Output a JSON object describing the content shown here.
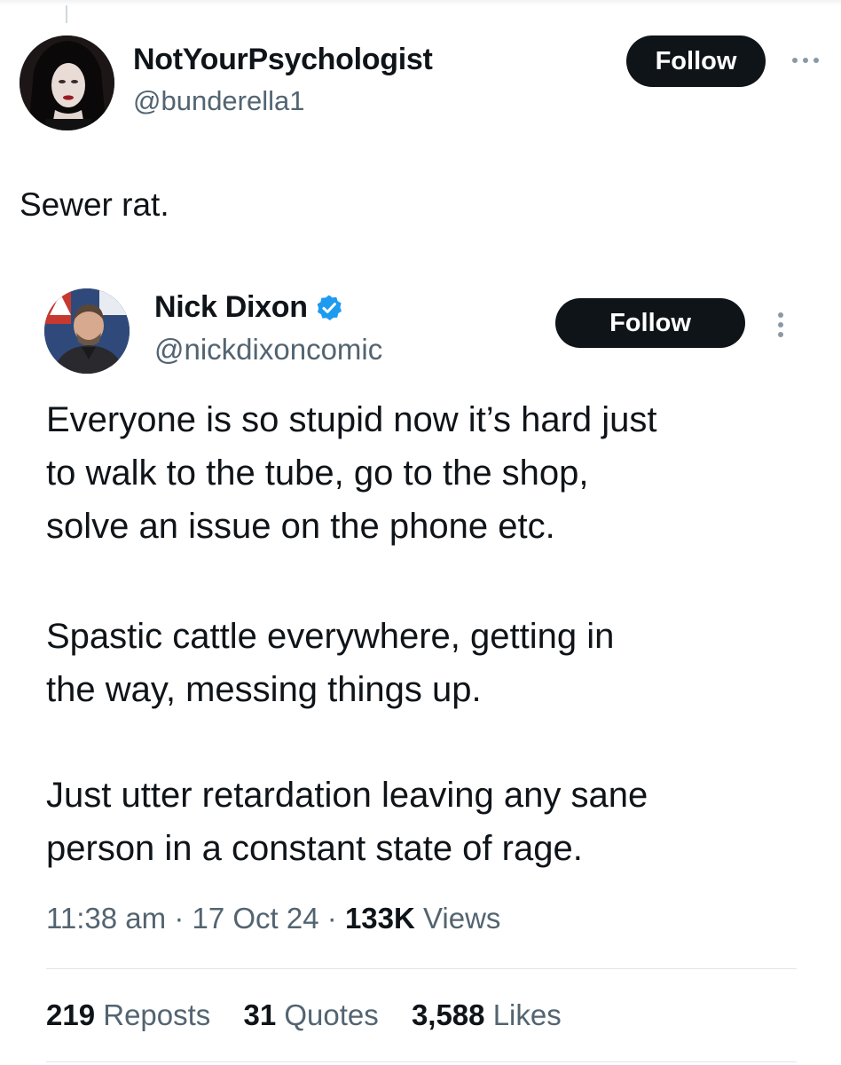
{
  "outer_tweet": {
    "author_name": "NotYourPsychologist",
    "handle": "@bunderella1",
    "follow_label": "Follow",
    "text": "Sewer rat."
  },
  "quoted_tweet": {
    "author_name": "Nick Dixon",
    "handle": "@nickdixoncomic",
    "verified": true,
    "follow_label": "Follow",
    "paragraphs": [
      [
        "Everyone is so stupid now it’s hard just",
        "to walk to the tube, go to the shop,",
        "solve an issue on the phone etc."
      ],
      [
        "Spastic cattle everywhere, getting in",
        "the way, messing things up."
      ],
      [
        "Just utter retardation leaving any sane",
        "person in a constant state of rage."
      ]
    ],
    "time": "11:38 am",
    "separator": "·",
    "date": "17 Oct 24",
    "views_count": "133K",
    "views_label": "Views",
    "stats": {
      "reposts_count": "219",
      "reposts_label": "Reposts",
      "quotes_count": "31",
      "quotes_label": "Quotes",
      "likes_count": "3,588",
      "likes_label": "Likes"
    }
  },
  "colors": {
    "text_primary": "#0f1419",
    "text_secondary": "#536471",
    "button_bg": "#0f1419",
    "verified_blue": "#1d9bf0",
    "divider": "#e1e6ea"
  },
  "icons": {
    "outer_more": "more-horizontal-icon",
    "inner_more": "more-vertical-icon",
    "verified": "verified-badge-icon"
  }
}
